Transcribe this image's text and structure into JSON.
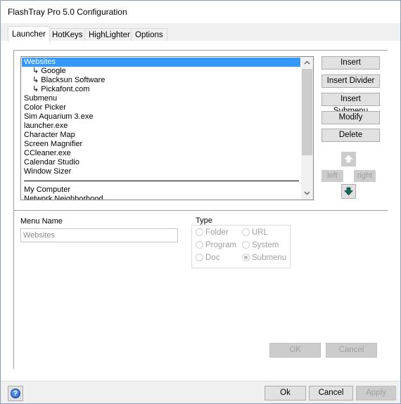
{
  "window": {
    "title": "FlashTray Pro 5.0 Configuration"
  },
  "tabs": [
    {
      "label": "Launcher",
      "active": true
    },
    {
      "label": "HotKeys",
      "active": false
    },
    {
      "label": "HighLighter",
      "active": false
    },
    {
      "label": "Options",
      "active": false
    }
  ],
  "launcher": {
    "menu_items": [
      {
        "label": "Websites",
        "type": "item",
        "selected": true
      },
      {
        "label": "↳ Google",
        "type": "sub"
      },
      {
        "label": "↳ Blacksun Software",
        "type": "sub"
      },
      {
        "label": "↳ Pickafont.com",
        "type": "sub"
      },
      {
        "label": "Submenu",
        "type": "item"
      },
      {
        "label": "Color Picker",
        "type": "item"
      },
      {
        "label": "Sim Aquarium 3.exe",
        "type": "item"
      },
      {
        "label": "launcher.exe",
        "type": "item"
      },
      {
        "label": "Character Map",
        "type": "item"
      },
      {
        "label": "Screen Magnifier",
        "type": "item"
      },
      {
        "label": "CCleaner.exe",
        "type": "item"
      },
      {
        "label": "Calendar Studio",
        "type": "item"
      },
      {
        "label": "Window Sizer",
        "type": "item"
      },
      {
        "label": "",
        "type": "divider"
      },
      {
        "label": "My Computer",
        "type": "item"
      },
      {
        "label": "Network Neighborhood",
        "type": "item"
      }
    ],
    "buttons": {
      "insert": "Insert",
      "insert_divider": "Insert Divider",
      "insert_submenu": "Insert Submenu",
      "modify": "Modify",
      "delete": "Delete"
    },
    "move": {
      "up_icon": "arrow-up-icon",
      "down_icon": "arrow-down-icon",
      "left": "left",
      "right": "right"
    },
    "editor": {
      "menu_name_label": "Menu Name",
      "menu_name_value": "Websites",
      "type_label": "Type",
      "type_options": [
        {
          "label": "Folder",
          "checked": false
        },
        {
          "label": "URL",
          "checked": false
        },
        {
          "label": "Program",
          "checked": false
        },
        {
          "label": "System",
          "checked": false
        },
        {
          "label": "Doc",
          "checked": false
        },
        {
          "label": "Submenu",
          "checked": true
        }
      ],
      "ok": "OK",
      "cancel": "Cancel"
    }
  },
  "footer": {
    "help_icon": "help-icon",
    "ok": "Ok",
    "cancel": "Cancel",
    "apply": "Apply"
  },
  "colors": {
    "selection": "#3399ff",
    "down_arrow": "#0f6b5e"
  }
}
